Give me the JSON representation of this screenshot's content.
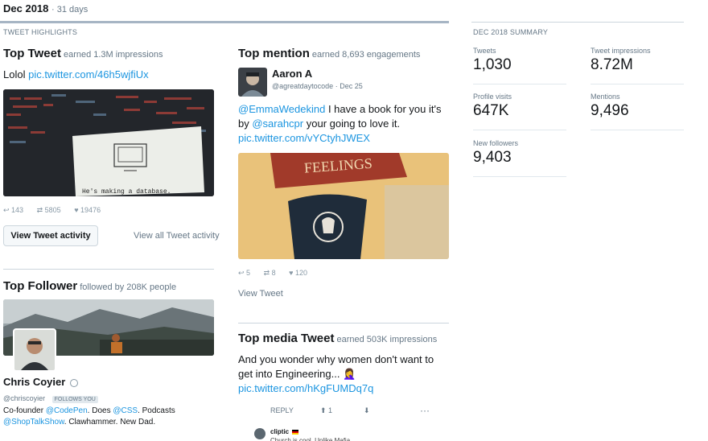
{
  "header": {
    "month": "Dec 2018",
    "days": "· 31 days"
  },
  "highlights": {
    "section_label": "TWEET HIGHLIGHTS",
    "top_tweet": {
      "title": "Top Tweet",
      "subtitle": "earned 1.3M impressions",
      "text": "Lolol",
      "link": "pic.twitter.com/46h5wjfiUx",
      "image_caption": "He's making a database.",
      "replies": "143",
      "retweets": "5805",
      "likes": "19476",
      "view_activity_label": "View Tweet activity",
      "view_all_label": "View all Tweet activity"
    },
    "top_follower": {
      "title": "Top Follower",
      "subtitle": "followed by 208K people",
      "name": "Chris Coyier",
      "handle": "@chriscoyier",
      "badge": "FOLLOWS YOU",
      "bio_1a": "Co-founder ",
      "bio_1b": "@CodePen",
      "bio_1c": ". Does ",
      "bio_1d": "@CSS",
      "bio_1e": ". Podcasts",
      "bio_2a": "@ShopTalkShow",
      "bio_2b": ". Clawhammer. New Dad."
    },
    "top_mention": {
      "title": "Top mention",
      "subtitle": "earned 8,693 engagements",
      "name": "Aaron A",
      "handle": "@agreatdaytocode",
      "date": "· Dec 25",
      "text_a": "@EmmaWedekind",
      "text_b": " I have a book for you it's by ",
      "text_c": "@sarahcpr",
      "text_d": " your going to love it.",
      "link": "pic.twitter.com/vYCtyhJWEX",
      "image_word": "FEELINGS",
      "replies": "5",
      "retweets": "8",
      "likes": "120",
      "view_label": "View Tweet"
    },
    "top_media": {
      "title": "Top media Tweet",
      "subtitle": "earned 503K impressions",
      "text": "And you wonder why women don't want to get into Engineering... 🤦‍♀️",
      "link": "pic.twitter.com/hKgFUMDq7q",
      "reply_label": "REPLY",
      "upvotes": "1",
      "more": "···",
      "commenter": "cliptic",
      "comment_snippet": "Church is cool. Unlike Mafia..."
    }
  },
  "summary": {
    "section_label": "DEC 2018 SUMMARY",
    "stats": [
      {
        "label": "Tweets",
        "value": "1,030"
      },
      {
        "label": "Tweet impressions",
        "value": "8.72M"
      },
      {
        "label": "Profile visits",
        "value": "647K"
      },
      {
        "label": "Mentions",
        "value": "9,496"
      },
      {
        "label": "New followers",
        "value": "9,403"
      }
    ]
  },
  "colors": {
    "link": "#1b95e0",
    "muted": "#657786",
    "divider": "#ccd6dd"
  }
}
